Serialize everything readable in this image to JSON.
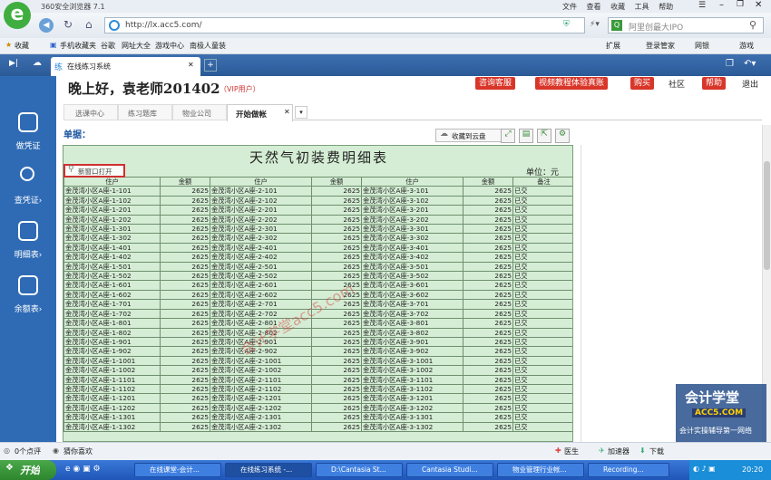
{
  "browser": {
    "title": "360安全浏览器 7.1",
    "menu": [
      "文件",
      "查看",
      "收藏",
      "工具",
      "帮助"
    ],
    "url": "http://lx.acc5.com/",
    "search_placeholder": "阿里创最大IPO"
  },
  "favorites": {
    "items": [
      "收藏",
      "手机收藏夹",
      "谷歌",
      "网址大全",
      "游戏中心",
      "南极人童装"
    ],
    "right": [
      "扩展",
      "登录管家",
      "网银",
      "游戏"
    ]
  },
  "tabs": [
    {
      "label": "在线练习系统"
    }
  ],
  "leftnav": [
    {
      "label": "做凭证"
    },
    {
      "label": "查凭证›"
    },
    {
      "label": "明细表›"
    },
    {
      "label": "余额表›"
    }
  ],
  "header": {
    "greeting": "晚上好，袁老师201402",
    "vip": "（VIP用户）",
    "buttons": [
      "咨询客服",
      "视频教程体验真账",
      "购买"
    ],
    "links": [
      "社区",
      "帮助",
      "退出"
    ]
  },
  "subtabs": [
    "选课中心",
    "练习题库",
    "物业公司",
    "开始做帐"
  ],
  "doc": {
    "label": "单据：",
    "cloud_btn": "收藏到云盘",
    "title": "天然气初装费明细表",
    "unit": "单位：元",
    "open_new": "新窗口打开",
    "watermark": "会计学堂acc5.com",
    "headers": [
      "住户",
      "金额",
      "住户",
      "金额",
      "住户",
      "金额",
      "备注"
    ],
    "rows": [
      [
        "金茂湾小区A座-1-101",
        "2625",
        "金茂湾小区A座-2-101",
        "2625",
        "金茂湾小区A座-3-101",
        "2625",
        "已交"
      ],
      [
        "金茂湾小区A座-1-102",
        "2625",
        "金茂湾小区A座-2-102",
        "2625",
        "金茂湾小区A座-3-102",
        "2625",
        "已交"
      ],
      [
        "金茂湾小区A座-1-201",
        "2625",
        "金茂湾小区A座-2-201",
        "2625",
        "金茂湾小区A座-3-201",
        "2625",
        "已交"
      ],
      [
        "金茂湾小区A座-1-202",
        "2625",
        "金茂湾小区A座-2-202",
        "2625",
        "金茂湾小区A座-3-202",
        "2625",
        "已交"
      ],
      [
        "金茂湾小区A座-1-301",
        "2625",
        "金茂湾小区A座-2-301",
        "2625",
        "金茂湾小区A座-3-301",
        "2625",
        "已交"
      ],
      [
        "金茂湾小区A座-1-302",
        "2625",
        "金茂湾小区A座-2-302",
        "2625",
        "金茂湾小区A座-3-302",
        "2625",
        "已交"
      ],
      [
        "金茂湾小区A座-1-401",
        "2625",
        "金茂湾小区A座-2-401",
        "2625",
        "金茂湾小区A座-3-401",
        "2625",
        "已交"
      ],
      [
        "金茂湾小区A座-1-402",
        "2625",
        "金茂湾小区A座-2-402",
        "2625",
        "金茂湾小区A座-3-402",
        "2625",
        "已交"
      ],
      [
        "金茂湾小区A座-1-501",
        "2625",
        "金茂湾小区A座-2-501",
        "2625",
        "金茂湾小区A座-3-501",
        "2625",
        "已交"
      ],
      [
        "金茂湾小区A座-1-502",
        "2625",
        "金茂湾小区A座-2-502",
        "2625",
        "金茂湾小区A座-3-502",
        "2625",
        "已交"
      ],
      [
        "金茂湾小区A座-1-601",
        "2625",
        "金茂湾小区A座-2-601",
        "2625",
        "金茂湾小区A座-3-601",
        "2625",
        "已交"
      ],
      [
        "金茂湾小区A座-1-602",
        "2625",
        "金茂湾小区A座-2-602",
        "2625",
        "金茂湾小区A座-3-602",
        "2625",
        "已交"
      ],
      [
        "金茂湾小区A座-1-701",
        "2625",
        "金茂湾小区A座-2-701",
        "2625",
        "金茂湾小区A座-3-701",
        "2625",
        "已交"
      ],
      [
        "金茂湾小区A座-1-702",
        "2625",
        "金茂湾小区A座-2-702",
        "2625",
        "金茂湾小区A座-3-702",
        "2625",
        "已交"
      ],
      [
        "金茂湾小区A座-1-801",
        "2625",
        "金茂湾小区A座-2-801",
        "2625",
        "金茂湾小区A座-3-801",
        "2625",
        "已交"
      ],
      [
        "金茂湾小区A座-1-802",
        "2625",
        "金茂湾小区A座-2-802",
        "2625",
        "金茂湾小区A座-3-802",
        "2625",
        "已交"
      ],
      [
        "金茂湾小区A座-1-901",
        "2625",
        "金茂湾小区A座-2-901",
        "2625",
        "金茂湾小区A座-3-901",
        "2625",
        "已交"
      ],
      [
        "金茂湾小区A座-1-902",
        "2625",
        "金茂湾小区A座-2-902",
        "2625",
        "金茂湾小区A座-3-902",
        "2625",
        "已交"
      ],
      [
        "金茂湾小区A座-1-1001",
        "2625",
        "金茂湾小区A座-2-1001",
        "2625",
        "金茂湾小区A座-3-1001",
        "2625",
        "已交"
      ],
      [
        "金茂湾小区A座-1-1002",
        "2625",
        "金茂湾小区A座-2-1002",
        "2625",
        "金茂湾小区A座-3-1002",
        "2625",
        "已交"
      ],
      [
        "金茂湾小区A座-1-1101",
        "2625",
        "金茂湾小区A座-2-1101",
        "2625",
        "金茂湾小区A座-3-1101",
        "2625",
        "已交"
      ],
      [
        "金茂湾小区A座-1-1102",
        "2625",
        "金茂湾小区A座-2-1102",
        "2625",
        "金茂湾小区A座-3-1102",
        "2625",
        "已交"
      ],
      [
        "金茂湾小区A座-1-1201",
        "2625",
        "金茂湾小区A座-2-1201",
        "2625",
        "金茂湾小区A座-3-1201",
        "2625",
        "已交"
      ],
      [
        "金茂湾小区A座-1-1202",
        "2625",
        "金茂湾小区A座-2-1202",
        "2625",
        "金茂湾小区A座-3-1202",
        "2625",
        "已交"
      ],
      [
        "金茂湾小区A座-1-1301",
        "2625",
        "金茂湾小区A座-2-1301",
        "2625",
        "金茂湾小区A座-3-1301",
        "2625",
        "已交"
      ],
      [
        "金茂湾小区A座-1-1302",
        "2625",
        "金茂湾小区A座-2-1302",
        "2625",
        "金茂湾小区A座-3-1302",
        "2625",
        "已交"
      ]
    ]
  },
  "status": {
    "left1": "0个点评",
    "left2": "猜你喜欢",
    "right": [
      "医生",
      "加速器",
      "下载"
    ]
  },
  "taskbar": {
    "start": "开始",
    "items": [
      "在线课堂-会计...",
      "在线练习系统 -...",
      "D:\\Cantasia St...",
      "Cantasia Studi...",
      "物业管理行业帐...",
      "Recording..."
    ],
    "time": "20:20"
  },
  "brand": {
    "name": "会计学堂",
    "domain": "ACC5.COM",
    "tagline": "会计实操辅导第一网络"
  }
}
